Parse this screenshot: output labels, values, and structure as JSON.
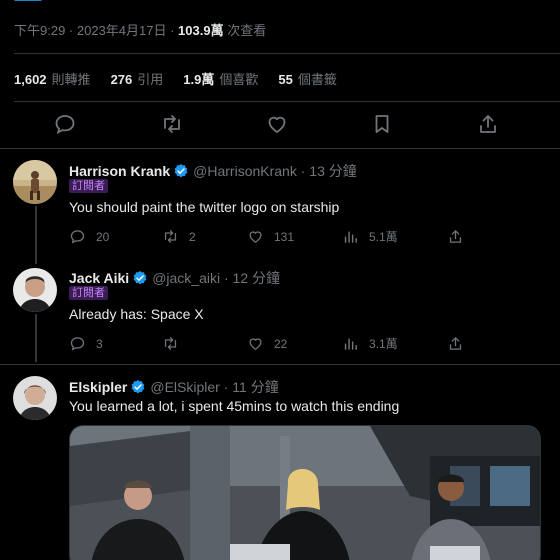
{
  "tweet": {
    "meta": {
      "time": "下午9:29 · 2023年4月17日 ·",
      "views_count": "103.9萬",
      "views_label": "次查看"
    },
    "stats": [
      {
        "value": "1,602",
        "label": "則轉推"
      },
      {
        "value": "276",
        "label": "引用"
      },
      {
        "value": "1.9萬",
        "label": "個喜歡"
      },
      {
        "value": "55",
        "label": "個書籤"
      }
    ],
    "actions": [
      {
        "icon": "reply-icon"
      },
      {
        "icon": "retweet-icon"
      },
      {
        "icon": "like-icon"
      },
      {
        "icon": "bookmark-icon"
      },
      {
        "icon": "share-icon"
      }
    ]
  },
  "replies": [
    {
      "name": "Harrison Krank",
      "handle": "@HarrisonKrank · 13 分鐘",
      "badge": "訂閱者",
      "text": "You should paint the twitter logo on starship",
      "reply_count": "20",
      "retweet_count": "2",
      "like_count": "131",
      "view_count": "5.1萬"
    },
    {
      "name": "Jack Aiki",
      "handle": "@jack_aiki · 12 分鐘",
      "badge": "訂閱者",
      "text": "Already has: Space X",
      "reply_count": "3",
      "retweet_count": "",
      "like_count": "22",
      "view_count": "3.1萬"
    },
    {
      "name": "Elskipler",
      "handle": "@ElSkipler · 11 分鐘",
      "badge": "",
      "text": "You learned a lot, i spent 45mins to watch this ending",
      "reply_count": "",
      "retweet_count": "",
      "like_count": "",
      "view_count": ""
    }
  ],
  "colors": {
    "background": "#000000",
    "text": "#e7e9ea",
    "muted": "#71767b",
    "verified": "#1d9bf0",
    "badge_text": "#c084fc",
    "badge_bg": "#3b1c52",
    "divider": "#2f3336"
  }
}
